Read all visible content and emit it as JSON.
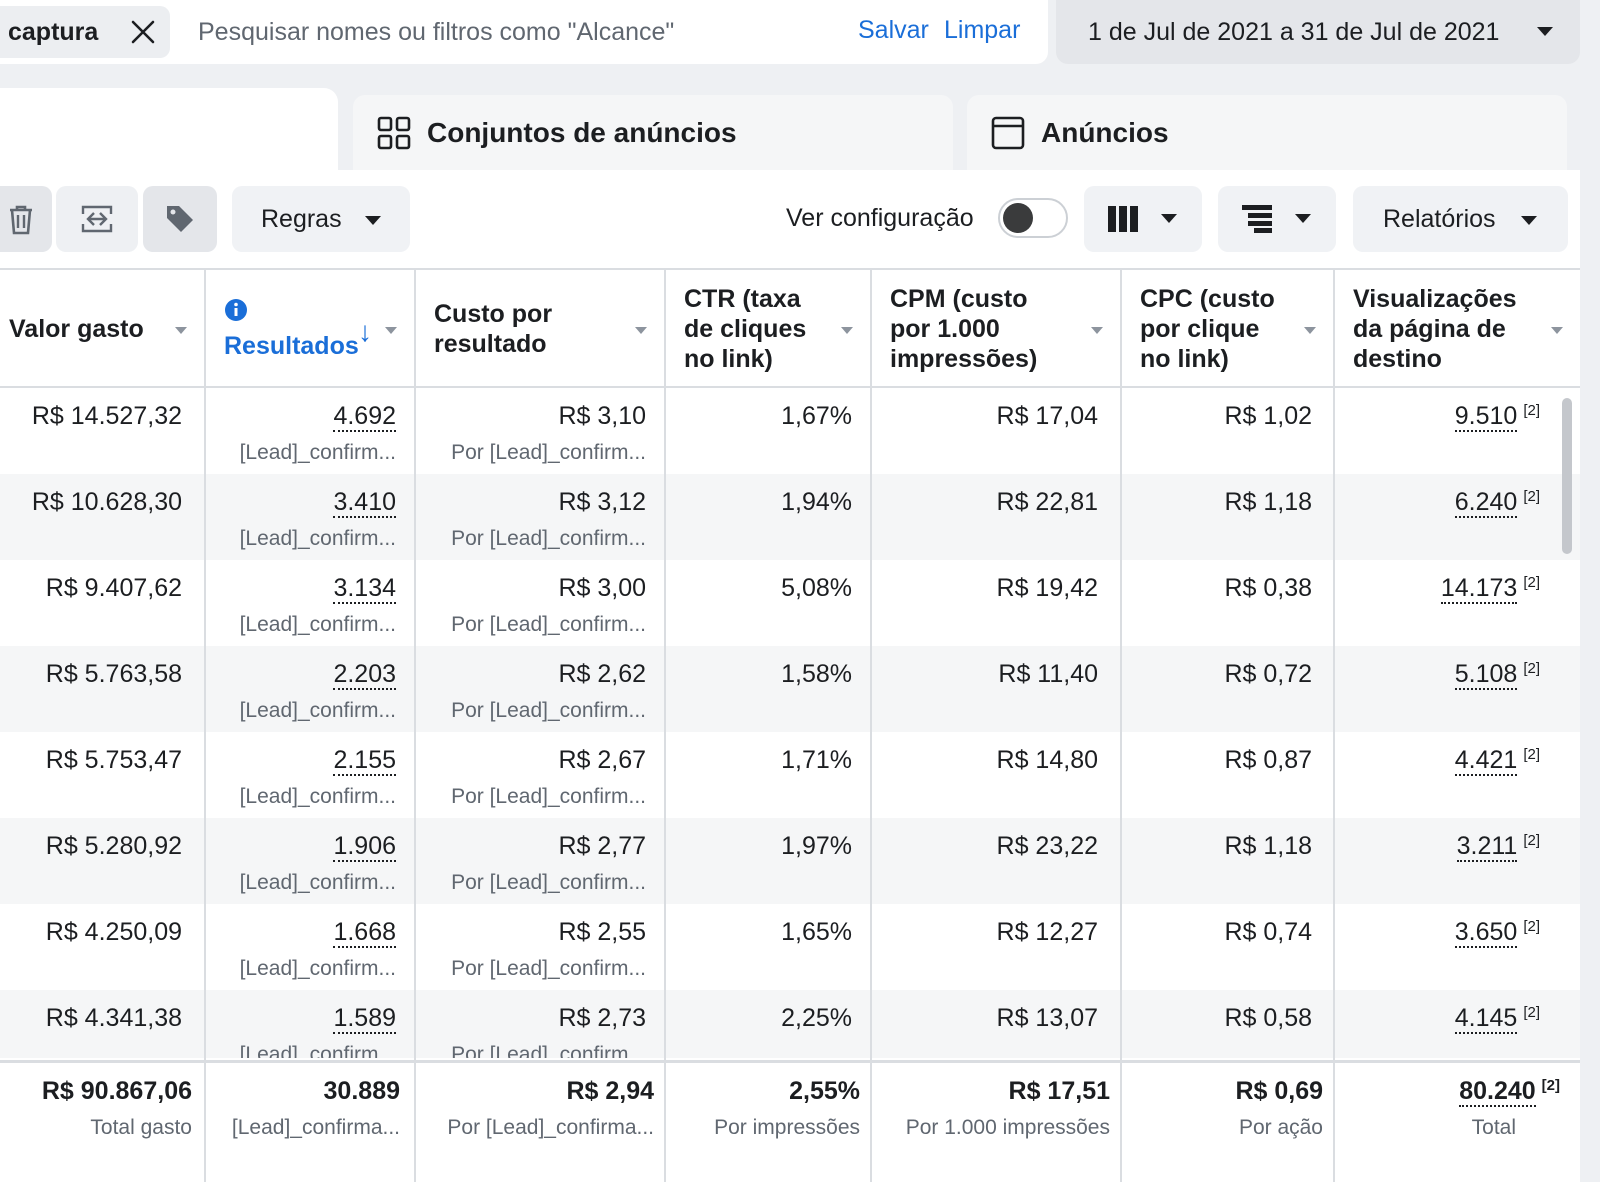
{
  "search": {
    "chip_label": "captura",
    "placeholder": "Pesquisar nomes ou filtros como \"Alcance\"",
    "save_label": "Salvar",
    "clear_label": "Limpar"
  },
  "date_range": "1 de Jul de 2021 a 31 de Jul de 2021",
  "tabs": {
    "adsets": "Conjuntos de anúncios",
    "ads": "Anúncios"
  },
  "toolbar": {
    "rules_label": "Regras",
    "view_config_label": "Ver configuração",
    "view_config_on": false,
    "reports_label": "Relatórios"
  },
  "columns": {
    "spent": "Valor gasto",
    "results": "Resultados",
    "cost_per_result": "Custo por\nresultado",
    "ctr": "CTR (taxa\nde cliques\nno link)",
    "cpm": "CPM (custo\npor 1.000\nimpressões)",
    "cpc": "CPC (custo\npor clique\nno link)",
    "landing_views": "Visualizações\nda página de\ndestino"
  },
  "rows": [
    {
      "spent": "R$ 14.527,32",
      "results": "4.692",
      "results_sub": "[Lead]_confirm...",
      "cpr": "R$ 3,10",
      "cpr_sub": "Por [Lead]_confirm...",
      "ctr": "1,67%",
      "cpm": "R$ 17,04",
      "cpc": "R$ 1,02",
      "lpv": "9.510",
      "lpv_note": "[2]"
    },
    {
      "spent": "R$ 10.628,30",
      "results": "3.410",
      "results_sub": "[Lead]_confirm...",
      "cpr": "R$ 3,12",
      "cpr_sub": "Por [Lead]_confirm...",
      "ctr": "1,94%",
      "cpm": "R$ 22,81",
      "cpc": "R$ 1,18",
      "lpv": "6.240",
      "lpv_note": "[2]"
    },
    {
      "spent": "R$ 9.407,62",
      "results": "3.134",
      "results_sub": "[Lead]_confirm...",
      "cpr": "R$ 3,00",
      "cpr_sub": "Por [Lead]_confirm...",
      "ctr": "5,08%",
      "cpm": "R$ 19,42",
      "cpc": "R$ 0,38",
      "lpv": "14.173",
      "lpv_note": "[2]"
    },
    {
      "spent": "R$ 5.763,58",
      "results": "2.203",
      "results_sub": "[Lead]_confirm...",
      "cpr": "R$ 2,62",
      "cpr_sub": "Por [Lead]_confirm...",
      "ctr": "1,58%",
      "cpm": "R$ 11,40",
      "cpc": "R$ 0,72",
      "lpv": "5.108",
      "lpv_note": "[2]"
    },
    {
      "spent": "R$ 5.753,47",
      "results": "2.155",
      "results_sub": "[Lead]_confirm...",
      "cpr": "R$ 2,67",
      "cpr_sub": "Por [Lead]_confirm...",
      "ctr": "1,71%",
      "cpm": "R$ 14,80",
      "cpc": "R$ 0,87",
      "lpv": "4.421",
      "lpv_note": "[2]"
    },
    {
      "spent": "R$ 5.280,92",
      "results": "1.906",
      "results_sub": "[Lead]_confirm...",
      "cpr": "R$ 2,77",
      "cpr_sub": "Por [Lead]_confirm...",
      "ctr": "1,97%",
      "cpm": "R$ 23,22",
      "cpc": "R$ 1,18",
      "lpv": "3.211",
      "lpv_note": "[2]"
    },
    {
      "spent": "R$ 4.250,09",
      "results": "1.668",
      "results_sub": "[Lead]_confirm...",
      "cpr": "R$ 2,55",
      "cpr_sub": "Por [Lead]_confirm...",
      "ctr": "1,65%",
      "cpm": "R$ 12,27",
      "cpc": "R$ 0,74",
      "lpv": "3.650",
      "lpv_note": "[2]"
    },
    {
      "spent": "R$ 4.341,38",
      "results": "1.589",
      "results_sub": "[Lead]_confirm...",
      "cpr": "R$ 2,73",
      "cpr_sub": "Por [Lead]_confirm...",
      "ctr": "2,25%",
      "cpm": "R$ 13,07",
      "cpc": "R$ 0,58",
      "lpv": "4.145",
      "lpv_note": "[2]"
    }
  ],
  "totals": {
    "spent": "R$ 90.867,06",
    "spent_sub": "Total gasto",
    "results": "30.889",
    "results_sub": "[Lead]_confirma...",
    "cpr": "R$ 2,94",
    "cpr_sub": "Por [Lead]_confirma...",
    "ctr": "2,55%",
    "ctr_sub": "Por impressões",
    "cpm": "R$ 17,51",
    "cpm_sub": "Por 1.000 impressões",
    "cpc": "R$ 0,69",
    "cpc_sub": "Por ação",
    "lpv": "80.240",
    "lpv_note": "[2]",
    "lpv_sub": "Total"
  },
  "colors": {
    "accent": "#1a6ed8",
    "row_alt": "#f5f6f7",
    "border": "#dadde1"
  }
}
